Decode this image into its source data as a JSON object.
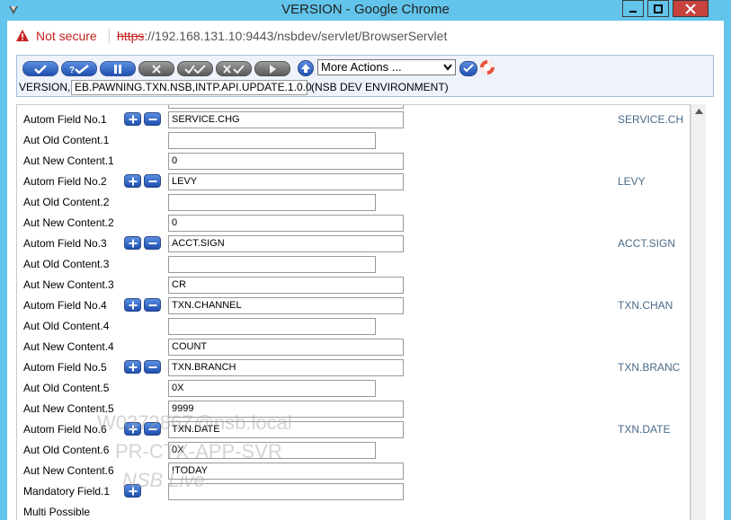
{
  "window": {
    "title": "VERSION - Google Chrome"
  },
  "addressbar": {
    "security_label": "Not secure",
    "url_scheme": "https",
    "url_rest": "://192.168.131.10:9443/nsbdev/servlet/BrowserServlet"
  },
  "toolbar": {
    "more_actions": "More Actions ...",
    "version_label": "VERSION,",
    "record_id": "EB.PAWNING.TXN.NSB,INTP.API.UPDATE.1.0.0",
    "environment": "(NSB DEV ENVIRONMENT)"
  },
  "rows": [
    {
      "label": "Autom Field No.1",
      "value": "SERVICE.CHG",
      "type": "field",
      "right": "SERVICE.CH"
    },
    {
      "label": "Aut Old Content.1",
      "value": "",
      "type": "old"
    },
    {
      "label": "Aut New Content.1",
      "value": "0",
      "type": "new"
    },
    {
      "label": "Autom Field No.2",
      "value": "LEVY",
      "type": "field",
      "right": "LEVY"
    },
    {
      "label": "Aut Old Content.2",
      "value": "",
      "type": "old"
    },
    {
      "label": "Aut New Content.2",
      "value": "0",
      "type": "new"
    },
    {
      "label": "Autom Field No.3",
      "value": "ACCT.SIGN",
      "type": "field",
      "right": "ACCT.SIGN"
    },
    {
      "label": "Aut Old Content.3",
      "value": "",
      "type": "old"
    },
    {
      "label": "Aut New Content.3",
      "value": "CR",
      "type": "new"
    },
    {
      "label": "Autom Field No.4",
      "value": "TXN.CHANNEL",
      "type": "field",
      "right": "TXN.CHAN"
    },
    {
      "label": "Aut Old Content.4",
      "value": "",
      "type": "old"
    },
    {
      "label": "Aut New Content.4",
      "value": "COUNT",
      "type": "new"
    },
    {
      "label": "Autom Field No.5",
      "value": "TXN.BRANCH",
      "type": "field",
      "right": "TXN.BRANC"
    },
    {
      "label": "Aut Old Content.5",
      "value": "0X",
      "type": "old"
    },
    {
      "label": "Aut New Content.5",
      "value": "9999",
      "type": "new"
    },
    {
      "label": "Autom Field No.6",
      "value": "TXN.DATE",
      "type": "field",
      "right": "TXN.DATE"
    },
    {
      "label": "Aut Old Content.6",
      "value": "0X",
      "type": "old"
    },
    {
      "label": "Aut New Content.6",
      "value": "!TODAY",
      "type": "new"
    },
    {
      "label": "Mandatory Field.1",
      "value": "",
      "type": "mandatory"
    },
    {
      "label": "Multi Possible",
      "value": "",
      "type": "label"
    }
  ],
  "watermark": {
    "line1": "W037286Z@nsb.local",
    "line2": "PR-CTX-APP-SVR",
    "line3": "NSB Live"
  }
}
